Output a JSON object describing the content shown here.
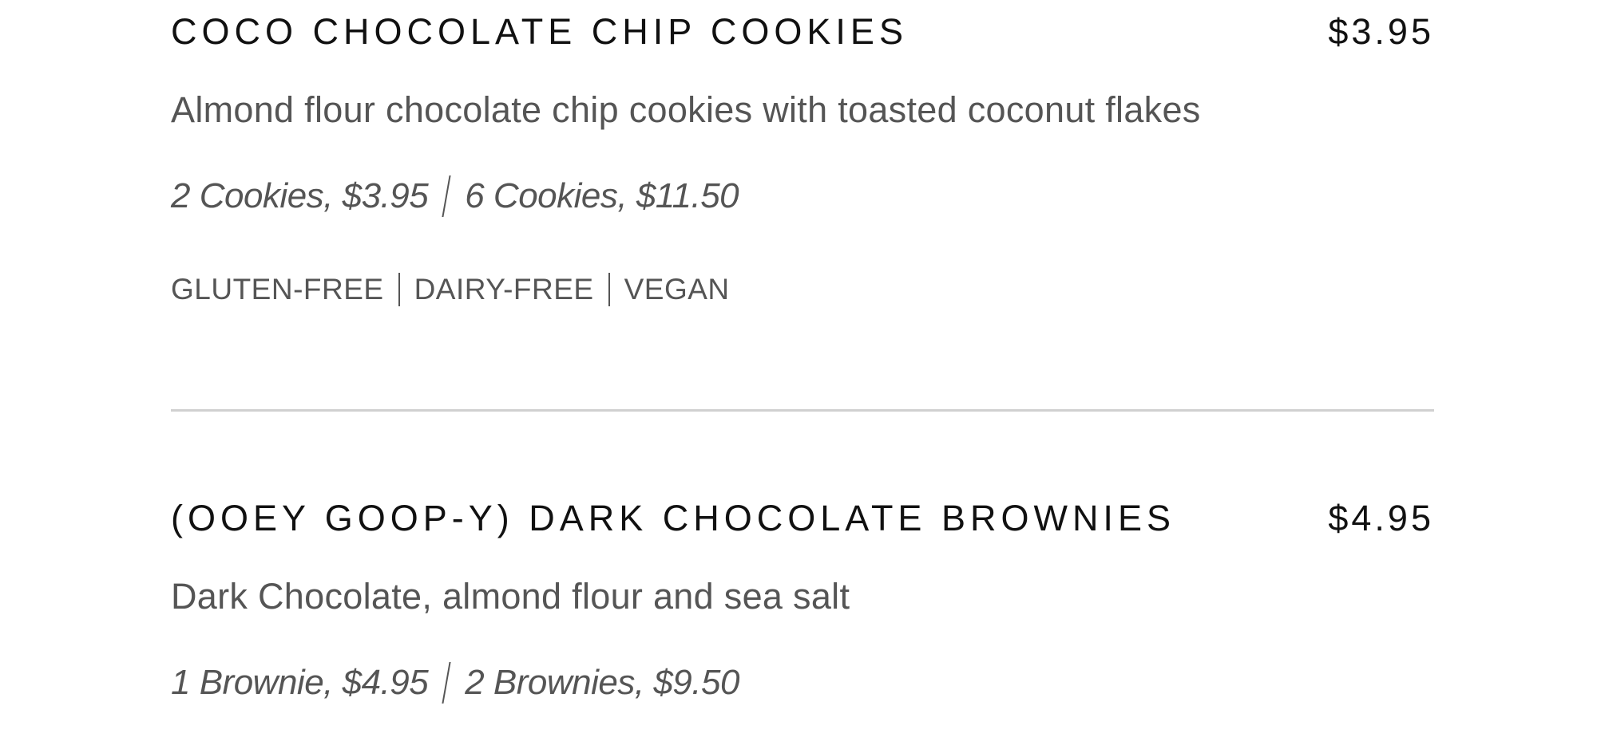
{
  "menu": {
    "items": [
      {
        "name": "COCO CHOCOLATE CHIP COOKIES",
        "price": "$3.95",
        "description": "Almond flour chocolate chip cookies with toasted coconut flakes",
        "options": [
          "2 Cookies, $3.95",
          "6 Cookies, $11.50"
        ],
        "tags": [
          "GLUTEN-FREE",
          "DAIRY-FREE",
          "VEGAN"
        ]
      },
      {
        "name": "(OOEY GOOP-Y) DARK CHOCOLATE BROWNIES",
        "price": "$4.95",
        "description": "Dark Chocolate, almond flour and sea salt",
        "options": [
          "1 Brownie, $4.95",
          "2 Brownies, $9.50"
        ]
      }
    ]
  },
  "colors": {
    "title": "#111111",
    "body": "#555555",
    "divider": "#d0d0d0",
    "background": "#ffffff"
  }
}
